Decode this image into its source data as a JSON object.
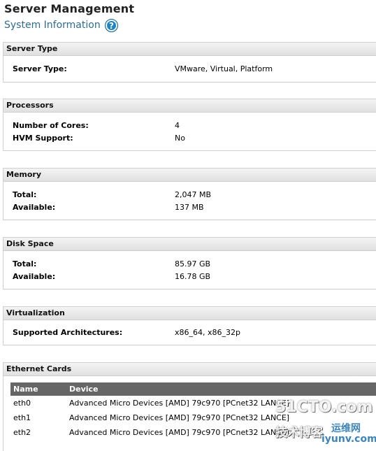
{
  "header": {
    "title": "Server Management",
    "subtitle": "System Information",
    "help_icon": "help-icon"
  },
  "server_type": {
    "heading": "Server Type",
    "rows": [
      {
        "label": "Server Type:",
        "value": "VMware, Virtual, Platform"
      }
    ]
  },
  "processors": {
    "heading": "Processors",
    "rows": [
      {
        "label": "Number of Cores:",
        "value": "4"
      },
      {
        "label": "HVM Support:",
        "value": "No"
      }
    ]
  },
  "memory": {
    "heading": "Memory",
    "rows": [
      {
        "label": "Total:",
        "value": "2,047 MB"
      },
      {
        "label": "Available:",
        "value": "137 MB"
      }
    ]
  },
  "disk": {
    "heading": "Disk Space",
    "rows": [
      {
        "label": "Total:",
        "value": "85.97 GB"
      },
      {
        "label": "Available:",
        "value": "16.78 GB"
      }
    ]
  },
  "virtualization": {
    "heading": "Virtualization",
    "rows": [
      {
        "label": "Supported Architectures:",
        "value": "x86_64, x86_32p"
      }
    ]
  },
  "ethernet": {
    "heading": "Ethernet Cards",
    "columns": [
      "Name",
      "Device"
    ],
    "rows": [
      {
        "name": "eth0",
        "device": "Advanced Micro Devices [AMD] 79c970 [PCnet32 LANCE]"
      },
      {
        "name": "eth1",
        "device": "Advanced Micro Devices [AMD] 79c970 [PCnet32 LANCE]"
      },
      {
        "name": "eth2",
        "device": "Advanced Micro Devices [AMD] 79c970 [PCnet32 LANCE]"
      }
    ]
  },
  "watermark": {
    "line1": "51CTO.com",
    "line2": "技术博客",
    "line3": "运维网",
    "line4": "iyunv.com"
  },
  "colors": {
    "accent": "#2f6d8e",
    "table_header": "#666666"
  }
}
